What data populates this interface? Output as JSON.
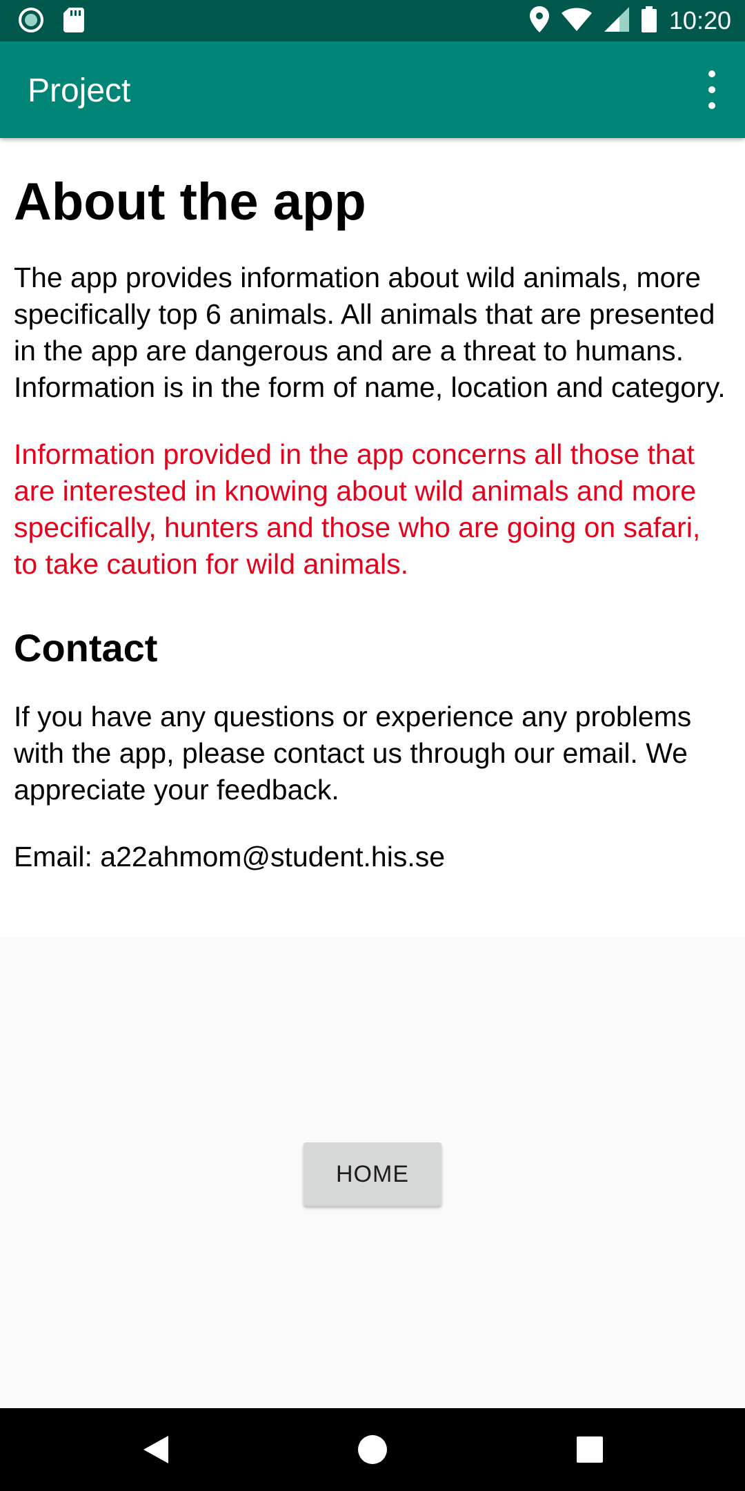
{
  "status_bar": {
    "time": "10:20",
    "left_icons": [
      "circle-notification-icon",
      "sd-card-icon"
    ],
    "right_icons": [
      "location-icon",
      "wifi-icon",
      "signal-icon",
      "battery-icon"
    ]
  },
  "app_bar": {
    "title": "Project",
    "menu_icon": "overflow-menu-icon"
  },
  "content": {
    "title": "About the app",
    "intro": "The app provides information about wild animals, more specifically top 6 animals. All animals that are presented in the app are dangerous and are a threat to humans. Information is in the form of name, location and category.",
    "warning": "Information provided in the app concerns all those that are interested in knowing about wild animals and more specifically, hunters and those who are going on safari, to take caution for wild animals.",
    "contact_heading": "Contact",
    "contact_text": "If you have any questions or experience any problems with the app, please contact us through our email. We appreciate your feedback.",
    "email": "Email: a22ahmom@student.his.se"
  },
  "home_button": {
    "label": "HOME"
  },
  "nav_bar": {
    "icons": [
      "back-icon",
      "home-icon",
      "recents-icon"
    ]
  },
  "colors": {
    "status_bar": "#00574b",
    "app_bar": "#008577",
    "warning_text": "#e5001b",
    "background": "#fafafa",
    "button": "#d6d7d7"
  }
}
